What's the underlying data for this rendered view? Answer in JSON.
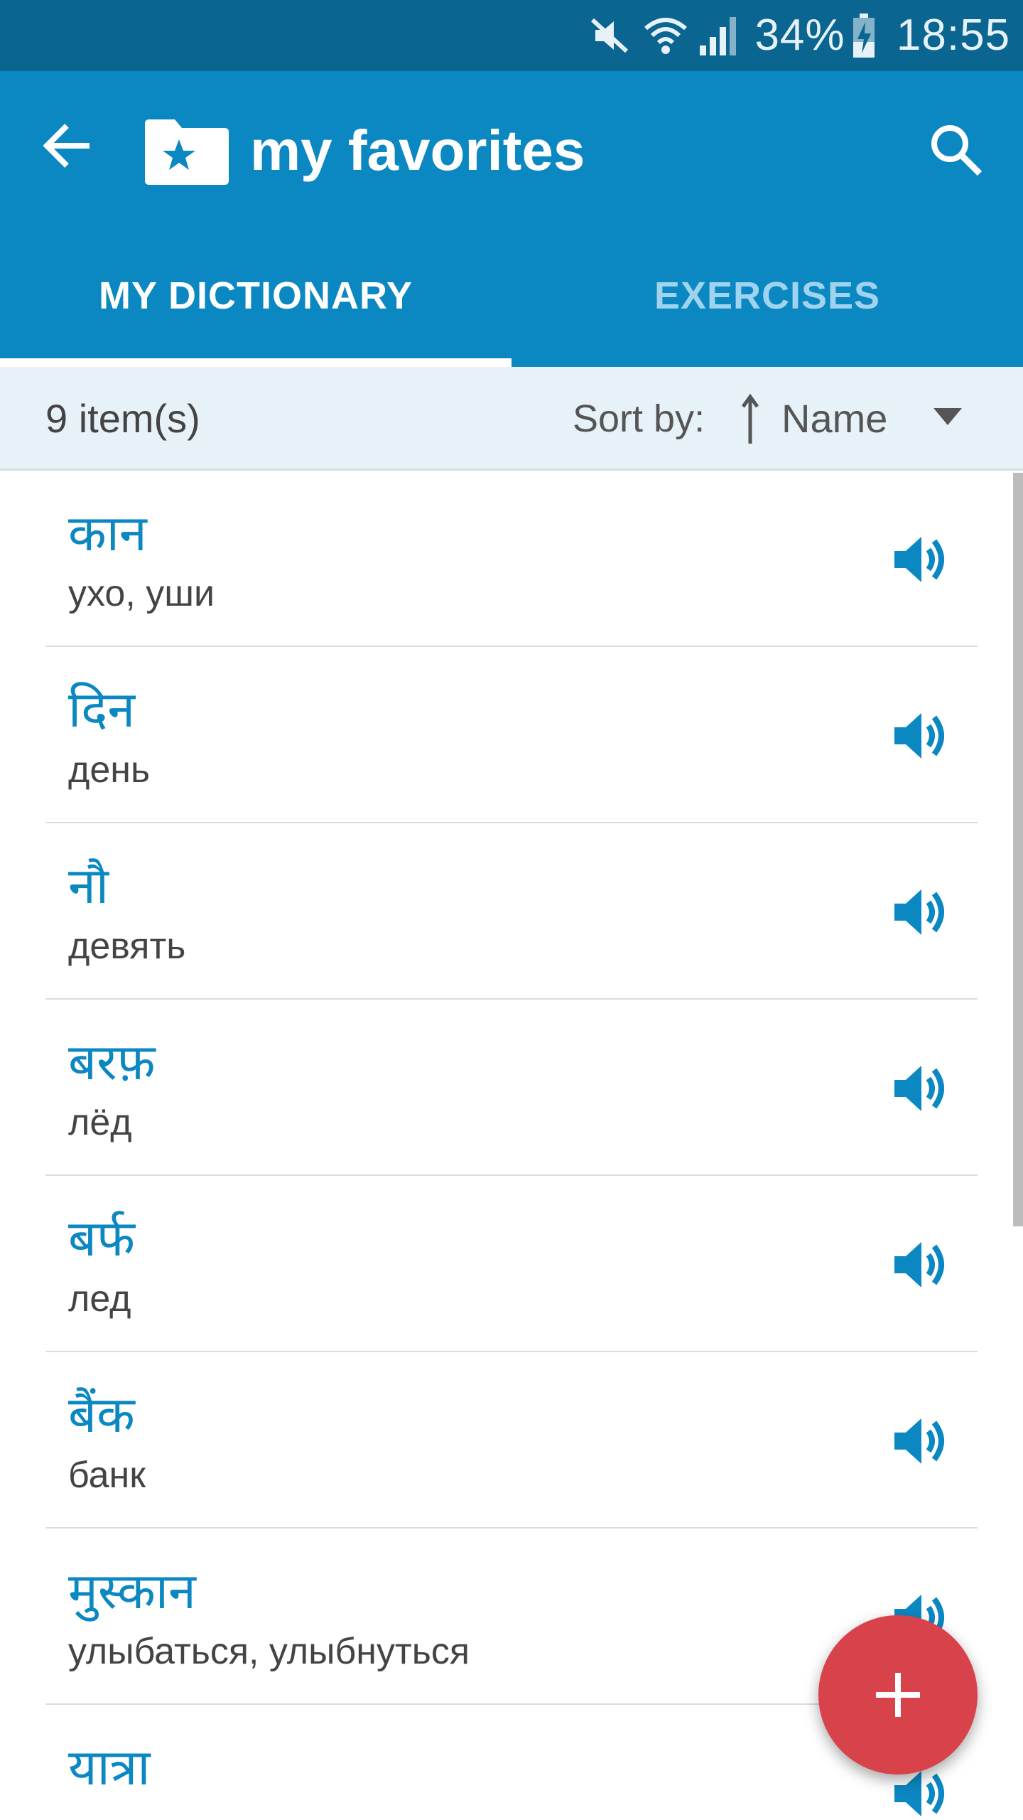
{
  "status_bar": {
    "icons": [
      "mute-icon",
      "wifi-icon",
      "signal-icon",
      "battery-charging-icon"
    ],
    "battery": "34%",
    "time": "18:55"
  },
  "app_bar": {
    "title": "my favorites",
    "back_icon": "arrow-back-icon",
    "title_icon": "star-folder-icon",
    "search_icon": "search-icon"
  },
  "tabs": [
    {
      "label": "MY DICTIONARY",
      "active": true
    },
    {
      "label": "EXERCISES",
      "active": false
    }
  ],
  "sort_bar": {
    "count": "9 item(s)",
    "sort_label": "Sort by:",
    "sort_value": "Name"
  },
  "items": [
    {
      "word": "कान",
      "translation": "ухо, уши"
    },
    {
      "word": "दिन",
      "translation": "день"
    },
    {
      "word": "नौ",
      "translation": "девять"
    },
    {
      "word": "बरफ़",
      "translation": "лёд"
    },
    {
      "word": "बर्फ",
      "translation": "лед"
    },
    {
      "word": "बैंक",
      "translation": "банк"
    },
    {
      "word": "मुस्कान",
      "translation": "улыбаться, улыбнуться"
    },
    {
      "word": "यात्रा",
      "translation": ""
    }
  ],
  "fab": {
    "icon": "plus-icon"
  },
  "colors": {
    "status_bar": "#0b6591",
    "primary": "#0b87c1",
    "accent": "#d8424a",
    "sort_bar": "#e6f2f8"
  }
}
